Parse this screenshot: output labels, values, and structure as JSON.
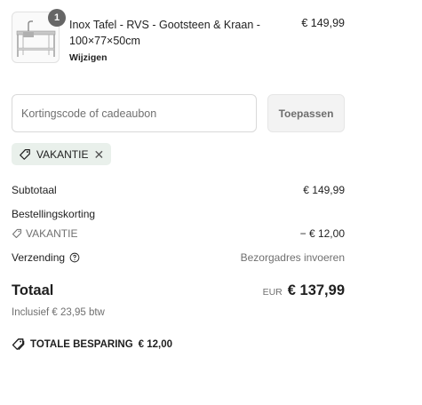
{
  "product": {
    "quantity": "1",
    "title": "Inox Tafel - RVS - Gootsteen & Kraan - 100×77×50cm",
    "edit_label": "Wijzigen",
    "price": "€ 149,99"
  },
  "discount": {
    "placeholder": "Kortingscode of cadeaubon",
    "value": "",
    "apply_label": "Toepassen",
    "applied_code": "VAKANTIE"
  },
  "summary": {
    "subtotal_label": "Subtotaal",
    "subtotal_value": "€ 149,99",
    "order_discount_label": "Bestellingskorting",
    "order_discount_code": "VAKANTIE",
    "order_discount_value": "− € 12,00",
    "shipping_label": "Verzending",
    "shipping_value": "Bezorgadres invoeren"
  },
  "total": {
    "label": "Totaal",
    "currency": "EUR",
    "amount": "€ 137,99",
    "vat_note": "Inclusief € 23,95 btw"
  },
  "savings": {
    "label": "TOTALE BESPARING",
    "amount": "€ 12,00"
  },
  "icons": {
    "tag": "tag-icon",
    "tags": "tags-icon",
    "help": "help-circle-icon",
    "close": "close-icon"
  },
  "colors": {
    "chip_background": "#e9f0eb",
    "badge": "#666666",
    "muted_text": "#707070"
  }
}
